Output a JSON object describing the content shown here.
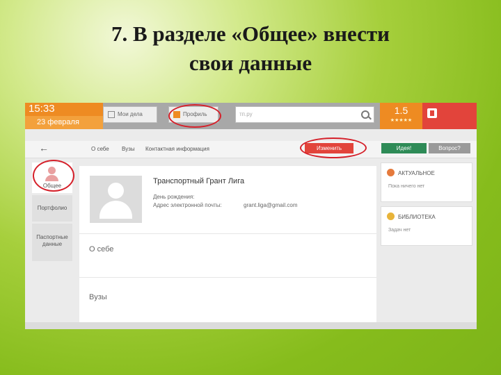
{
  "slide": {
    "title_line1": "7. В разделе «Общее» внести",
    "title_line2": "свои данные"
  },
  "topbar": {
    "time": "15:33",
    "date": "23 февраля",
    "tab_deals": "Мои дела",
    "tab_profile": "Профиль",
    "search_placeholder": "тп.ру",
    "rating_value": "1.5",
    "rating_stars": "★★★★★"
  },
  "toolbar": {
    "crumbs": [
      "О себе",
      "Вузы",
      "Контактная информация"
    ],
    "edit_button": "Изменить",
    "idea_button": "Идея!",
    "ask_button": "Вопрос?"
  },
  "nav": {
    "general": "Общее",
    "portfolio": "Портфолио",
    "passport_line1": "Паспортные",
    "passport_line2": "данные"
  },
  "profile": {
    "name": "Транспортный Грант Лига",
    "birthday_label": "День рождения:",
    "email_label": "Адрес электронной почты:",
    "email_value": "grant.liga@gmail.com",
    "section_about": "О себе",
    "section_universities": "Вузы"
  },
  "panels": {
    "panel1_title": "АКТУАЛЬНОЕ",
    "panel1_sub": "Пока ничего нет",
    "panel2_title": "БИБЛИОТЕКА",
    "panel2_sub": "Задач нет"
  },
  "colors": {
    "accent": "#ee8b22",
    "danger": "#e2443b",
    "success": "#2e8b57",
    "annotation": "#d5202a"
  }
}
